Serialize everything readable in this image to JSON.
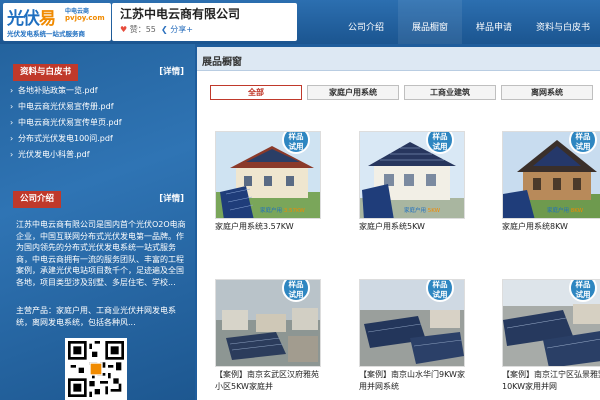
{
  "header": {
    "logo_main_1": "光伏",
    "logo_main_2": "易",
    "logo_small_1": "中电云商",
    "logo_small_2": "pvjoy.com",
    "logo_slogan": "光伏发电系统一站式服务商",
    "company_name": "江苏中电云商有限公司",
    "likes_label": "赞",
    "likes_count": "55",
    "share_label": "分享",
    "nav": [
      "公司介绍",
      "展品橱窗",
      "样品申请",
      "资料与白皮书"
    ]
  },
  "sidebar": {
    "docs_title": "资料与白皮书",
    "docs_more": "[详情]",
    "docs": [
      "各地补贴政策一览.pdf",
      "中电云商光伏易宣传册.pdf",
      "中电云商光伏易宣传单页.pdf",
      "分布式光伏发电100问.pdf",
      "光伏发电小科普.pdf"
    ],
    "intro_title": "公司介绍",
    "intro_more": "[详情]",
    "intro_text": "江苏中电云商有限公司是国内首个光伏O2O电商企业，中国互联网分布式光伏发电第一品牌。作为国内领先的分布式光伏发电系统一站式服务商，中电云商拥有一流的服务团队、丰富的工程案例，承建光伏电站项目数千个，足迹遍及全国各地，项目类型涉及别墅、多层住宅、学校...",
    "intro_text2": "主营产品：家庭户用、工商业光伏并网发电系统，离网发电系统，包括各种风..."
  },
  "main": {
    "title": "展品橱窗",
    "tabs": [
      "全部",
      "家庭户用系统",
      "工商业建筑",
      "离网系统"
    ],
    "badge_label_1": "样品",
    "badge_label_2": "试用",
    "products": [
      {
        "caption": "家庭户用系统3.57KW",
        "img_text": "家庭户用",
        "img_kw": "3.57KW"
      },
      {
        "caption": "家庭户用系统5KW",
        "img_text": "家庭户用",
        "img_kw": "5KW"
      },
      {
        "caption": "家庭户用系统8KW",
        "img_text": "家庭户用",
        "img_kw": "8KW"
      },
      {
        "caption": "【案例】南京玄武区汉府雅苑小区5KW家庭并",
        "img_text": "",
        "img_kw": ""
      },
      {
        "caption": "【案例】南京山水华门9KW家用并网系统",
        "img_text": "",
        "img_kw": ""
      },
      {
        "caption": "【案例】南京江宁区弘景雅墅10KW家用并网",
        "img_text": "",
        "img_kw": ""
      }
    ]
  },
  "colors": {
    "accent": "#1f5d9c",
    "badge": "#2e86c1",
    "active_tab": "#c0392b",
    "orange": "#f08a00"
  }
}
